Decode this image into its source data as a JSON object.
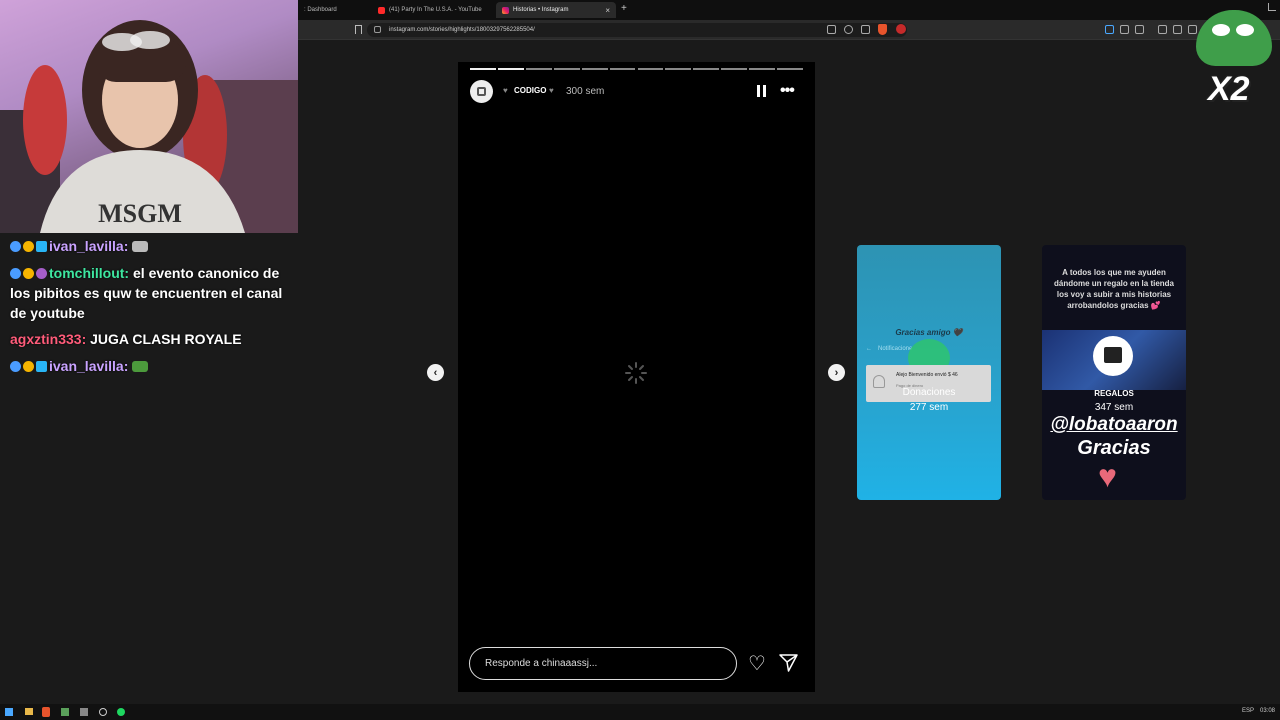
{
  "browser": {
    "tabs": [
      {
        "label": ": Dashboard"
      },
      {
        "label": "(41) Party In The U.S.A. - YouTube"
      },
      {
        "label": "Historias • Instagram",
        "close": "×"
      }
    ],
    "new_tab": "+",
    "url": "instagram.com/stories/highlights/18003297562285504/"
  },
  "chat": {
    "messages": [
      {
        "user": "ivan_lavilla:",
        "text": "",
        "user_color": "#c9a3ff"
      },
      {
        "user": "tomchillout:",
        "text": "el evento canonico de los pibitos es quw te encuentren el canal de youtube",
        "user_color": "#3ee6a0"
      },
      {
        "user": "agxztin333:",
        "text": "JUGA CLASH ROYALE",
        "user_color": "#ff5c7a"
      },
      {
        "user": "ivan_lavilla:",
        "text": "",
        "user_color": "#c9a3ff"
      }
    ]
  },
  "story": {
    "username": "CODIGO",
    "time": "300 sem",
    "reply_placeholder": "Responde a chinaaassj...",
    "progress_segments": 12
  },
  "previews": [
    {
      "caption_top": "Gracias amigo 🖤",
      "inner_header": "Notificacione",
      "notif_text": "Alejo Bienvenido envió $ 46",
      "notif_sub": "Pago de dinero",
      "title": "Donaciones",
      "time": "277 sem"
    },
    {
      "caption_top": "A todos los que me ayuden dándome un regalo en la tienda los voy a subir a mis historias arrobandolos gracias 💕",
      "title": "REGALOS",
      "time": "347 sem",
      "handle": "@lobatoaaron",
      "thanks": "Gracias"
    }
  ],
  "overlay": {
    "multiplier": "X2"
  },
  "taskbar": {
    "lang": "ESP",
    "clock": "03:08"
  },
  "colors": {
    "accent_orange": "#e8542c",
    "story_bg": "#000000",
    "page_bg": "#1a1a1a"
  }
}
